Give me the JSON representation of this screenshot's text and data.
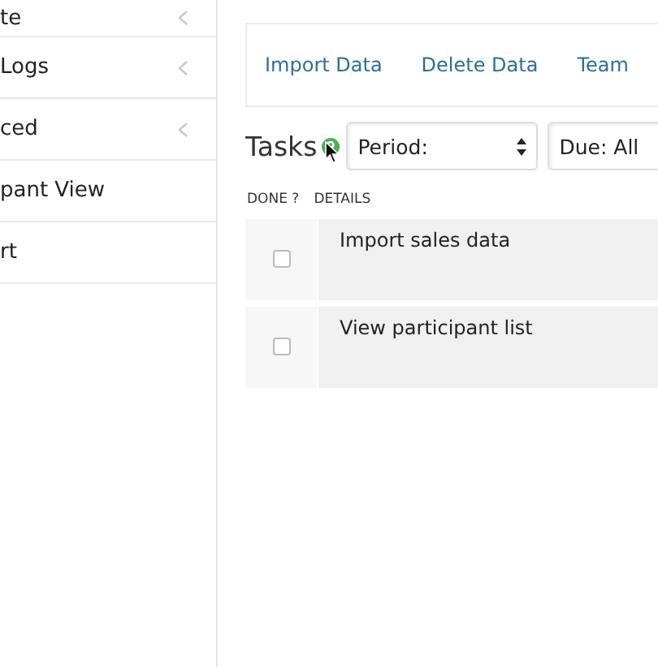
{
  "sidebar": {
    "items": [
      {
        "label": "te",
        "expandable": true
      },
      {
        "label": "Logs",
        "expandable": true
      },
      {
        "label": "ced",
        "expandable": true
      },
      {
        "label": "pant View",
        "expandable": false
      },
      {
        "label": "rt",
        "expandable": false
      }
    ]
  },
  "hotlinks": {
    "links": [
      "Import Data",
      "Delete Data",
      "Team"
    ]
  },
  "tasks": {
    "title": "Tasks",
    "filters": [
      {
        "label": "Period:",
        "kind": "spinner"
      },
      {
        "label": "Due: All",
        "kind": "plain"
      }
    ],
    "columns": [
      "DONE ?",
      "DETAILS"
    ],
    "rows": [
      {
        "details": "Import sales data",
        "done": false
      },
      {
        "details": "View participant list",
        "done": false
      }
    ]
  }
}
